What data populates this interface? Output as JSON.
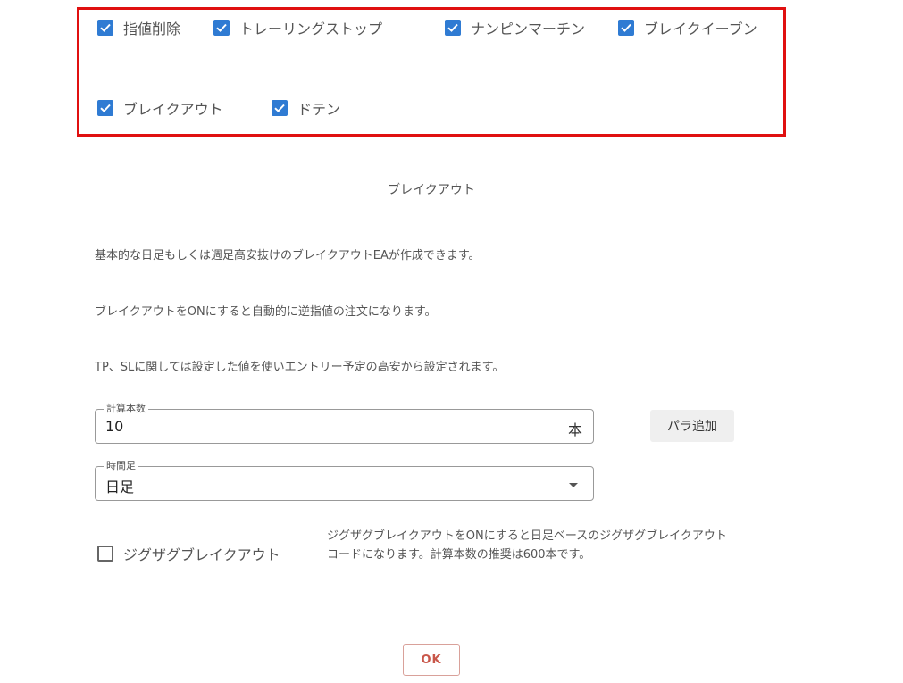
{
  "options": {
    "items": [
      {
        "label": "指値削除",
        "checked": true
      },
      {
        "label": "トレーリングストップ",
        "checked": true
      },
      {
        "label": "ナンピンマーチン",
        "checked": true
      },
      {
        "label": "ブレイクイーブン",
        "checked": true
      },
      {
        "label": "ブレイクアウト",
        "checked": true
      },
      {
        "label": "ドテン",
        "checked": true
      }
    ]
  },
  "dialog": {
    "title": "ブレイクアウト",
    "descriptions": [
      "基本的な日足もしくは週足高安抜けのブレイクアウトEAが作成できます。",
      "ブレイクアウトをONにすると自動的に逆指値の注文になります。",
      "TP、SLに関しては設定した値を使いエントリー予定の高安から設定されます。"
    ],
    "calc_count": {
      "label": "計算本数",
      "value": "10",
      "suffix": "本"
    },
    "add_param_button": "パラ追加",
    "timeframe": {
      "label": "時間足",
      "value": "日足"
    },
    "zigzag": {
      "label": "ジグザグブレイクアウト",
      "checked": false,
      "description_line1": "ジグザグブレイクアウトをONにすると日足ベースのジグザグブレイクアウト",
      "description_line2": "コードになります。計算本数の推奨は600本です。"
    },
    "ok_button": "OK"
  },
  "colors": {
    "highlight_border": "#e01010",
    "checkbox_checked": "#2f7bd3",
    "ok_text": "#c9574a"
  }
}
